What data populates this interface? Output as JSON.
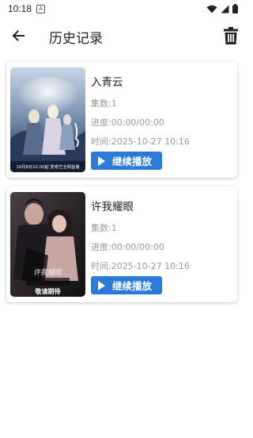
{
  "status": {
    "time": "10:18",
    "notif_letter": "A"
  },
  "header": {
    "title": "历史记录"
  },
  "history": [
    {
      "title": "入青云",
      "episode": "集数:1",
      "progress": "进度:00:00/00:00",
      "time": "时间:2025-10-27 10:16",
      "button": "继续播放",
      "poster_caption": "10月8日12:00起 爱奇艺全网首播",
      "poster_title": "入青云"
    },
    {
      "title": "许我耀眼",
      "episode": "集数:1",
      "progress": "进度:00:00/00:00",
      "time": "时间:2025-10-27 10:16",
      "button": "继续播放",
      "poster_caption": "敬请期待",
      "poster_title": "许我耀眼"
    }
  ],
  "colors": {
    "accent": "#2b7ad8"
  }
}
